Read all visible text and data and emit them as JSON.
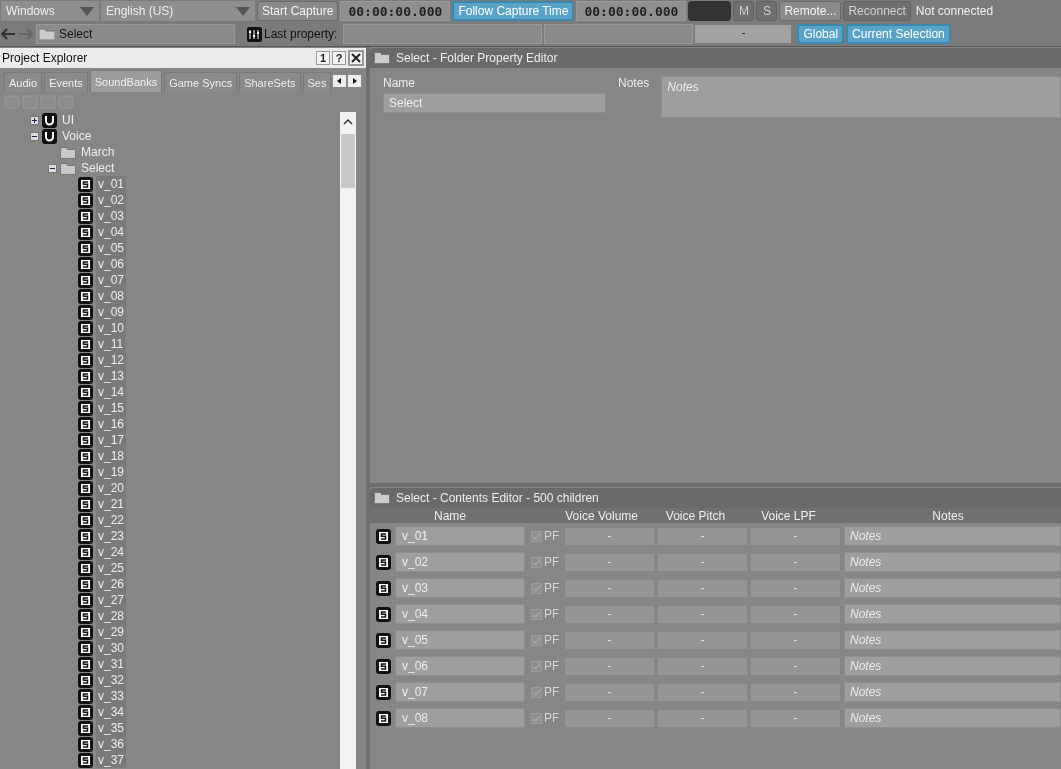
{
  "toolbar": {
    "platform": "Windows",
    "language": "English (US)",
    "start_capture": "Start Capture",
    "capture_time": "00:00:00.000",
    "follow_capture_time": {
      "label": "Follow Capture Time",
      "on": true
    },
    "follow_time": "00:00:00.000",
    "mute": {
      "label": "M",
      "disabled": true
    },
    "solo": {
      "label": "S",
      "disabled": true
    },
    "remote": "Remote...",
    "reconnect": {
      "label": "Reconnect",
      "disabled": true
    },
    "status": "Not connected"
  },
  "toolbar2": {
    "path": "Select",
    "last_property_label": "Last property:",
    "property_value": "-",
    "scope_buttons": [
      {
        "label": "Global",
        "on": true
      },
      {
        "label": "Current Selection",
        "on": true
      }
    ]
  },
  "project_explorer": {
    "title": "Project Explorer",
    "header_buttons": [
      "1",
      "?"
    ],
    "tabs": [
      {
        "label": "Audio",
        "selected": false
      },
      {
        "label": "Events",
        "selected": false
      },
      {
        "label": "SoundBanks",
        "selected": true
      },
      {
        "label": "Game Syncs",
        "selected": false
      },
      {
        "label": "ShareSets",
        "selected": false
      },
      {
        "label": "Ses",
        "selected": false
      }
    ],
    "tree": [
      {
        "label": "UI",
        "kind": "workunit",
        "expanded": false,
        "selected": false
      },
      {
        "label": "Voice",
        "kind": "workunit",
        "expanded": true,
        "selected": false,
        "children": [
          {
            "label": "March",
            "kind": "folder",
            "selected": false
          },
          {
            "label": "Select",
            "kind": "folder",
            "expanded": true,
            "selected": false,
            "children": [
              {
                "label": "v_01",
                "kind": "soundbank",
                "selected": true
              },
              {
                "label": "v_02",
                "kind": "soundbank",
                "selected": true
              },
              {
                "label": "v_03",
                "kind": "soundbank",
                "selected": true
              },
              {
                "label": "v_04",
                "kind": "soundbank",
                "selected": true
              },
              {
                "label": "v_05",
                "kind": "soundbank",
                "selected": true
              },
              {
                "label": "v_06",
                "kind": "soundbank",
                "selected": true
              },
              {
                "label": "v_07",
                "kind": "soundbank",
                "selected": true
              },
              {
                "label": "v_08",
                "kind": "soundbank",
                "selected": true
              },
              {
                "label": "v_09",
                "kind": "soundbank",
                "selected": true
              },
              {
                "label": "v_10",
                "kind": "soundbank",
                "selected": true
              },
              {
                "label": "v_11",
                "kind": "soundbank",
                "selected": true
              },
              {
                "label": "v_12",
                "kind": "soundbank",
                "selected": true
              },
              {
                "label": "v_13",
                "kind": "soundbank",
                "selected": true
              },
              {
                "label": "v_14",
                "kind": "soundbank",
                "selected": true
              },
              {
                "label": "v_15",
                "kind": "soundbank",
                "selected": true
              },
              {
                "label": "v_16",
                "kind": "soundbank",
                "selected": true
              },
              {
                "label": "v_17",
                "kind": "soundbank",
                "selected": true
              },
              {
                "label": "v_18",
                "kind": "soundbank",
                "selected": true
              },
              {
                "label": "v_19",
                "kind": "soundbank",
                "selected": true
              },
              {
                "label": "v_20",
                "kind": "soundbank",
                "selected": true
              },
              {
                "label": "v_21",
                "kind": "soundbank",
                "selected": true
              },
              {
                "label": "v_22",
                "kind": "soundbank",
                "selected": true
              },
              {
                "label": "v_23",
                "kind": "soundbank",
                "selected": true
              },
              {
                "label": "v_24",
                "kind": "soundbank",
                "selected": true
              },
              {
                "label": "v_25",
                "kind": "soundbank",
                "selected": true
              },
              {
                "label": "v_26",
                "kind": "soundbank",
                "selected": true
              },
              {
                "label": "v_27",
                "kind": "soundbank",
                "selected": true
              },
              {
                "label": "v_28",
                "kind": "soundbank",
                "selected": true
              },
              {
                "label": "v_29",
                "kind": "soundbank",
                "selected": true
              },
              {
                "label": "v_30",
                "kind": "soundbank",
                "selected": true
              },
              {
                "label": "v_31",
                "kind": "soundbank",
                "selected": true
              },
              {
                "label": "v_32",
                "kind": "soundbank",
                "selected": true
              },
              {
                "label": "v_33",
                "kind": "soundbank",
                "selected": true
              },
              {
                "label": "v_34",
                "kind": "soundbank",
                "selected": true
              },
              {
                "label": "v_35",
                "kind": "soundbank",
                "selected": true
              },
              {
                "label": "v_36",
                "kind": "soundbank",
                "selected": true
              },
              {
                "label": "v_37",
                "kind": "soundbank",
                "selected": true
              }
            ]
          }
        ]
      }
    ]
  },
  "property_editor": {
    "title": "Select - Folder Property Editor",
    "name_label": "Name",
    "name_value": "Select",
    "notes_label": "Notes",
    "notes_placeholder": "Notes"
  },
  "contents_editor": {
    "title": "Select - Contents Editor - 500 children",
    "columns": [
      "Name",
      "Voice Volume",
      "Voice Pitch",
      "Voice LPF",
      "Notes"
    ],
    "rows": [
      {
        "name": "v_01",
        "pf_label": "PF",
        "pf_checked": true,
        "values": [
          "-",
          "-",
          "-"
        ],
        "notes_placeholder": "Notes"
      },
      {
        "name": "v_02",
        "pf_label": "PF",
        "pf_checked": true,
        "values": [
          "-",
          "-",
          "-"
        ],
        "notes_placeholder": "Notes"
      },
      {
        "name": "v_03",
        "pf_label": "PF",
        "pf_checked": true,
        "values": [
          "-",
          "-",
          "-"
        ],
        "notes_placeholder": "Notes"
      },
      {
        "name": "v_04",
        "pf_label": "PF",
        "pf_checked": true,
        "values": [
          "-",
          "-",
          "-"
        ],
        "notes_placeholder": "Notes"
      },
      {
        "name": "v_05",
        "pf_label": "PF",
        "pf_checked": true,
        "values": [
          "-",
          "-",
          "-"
        ],
        "notes_placeholder": "Notes"
      },
      {
        "name": "v_06",
        "pf_label": "PF",
        "pf_checked": true,
        "values": [
          "-",
          "-",
          "-"
        ],
        "notes_placeholder": "Notes"
      },
      {
        "name": "v_07",
        "pf_label": "PF",
        "pf_checked": true,
        "values": [
          "-",
          "-",
          "-"
        ],
        "notes_placeholder": "Notes"
      },
      {
        "name": "v_08",
        "pf_label": "PF",
        "pf_checked": true,
        "values": [
          "-",
          "-",
          "-"
        ],
        "notes_placeholder": "Notes"
      }
    ]
  }
}
